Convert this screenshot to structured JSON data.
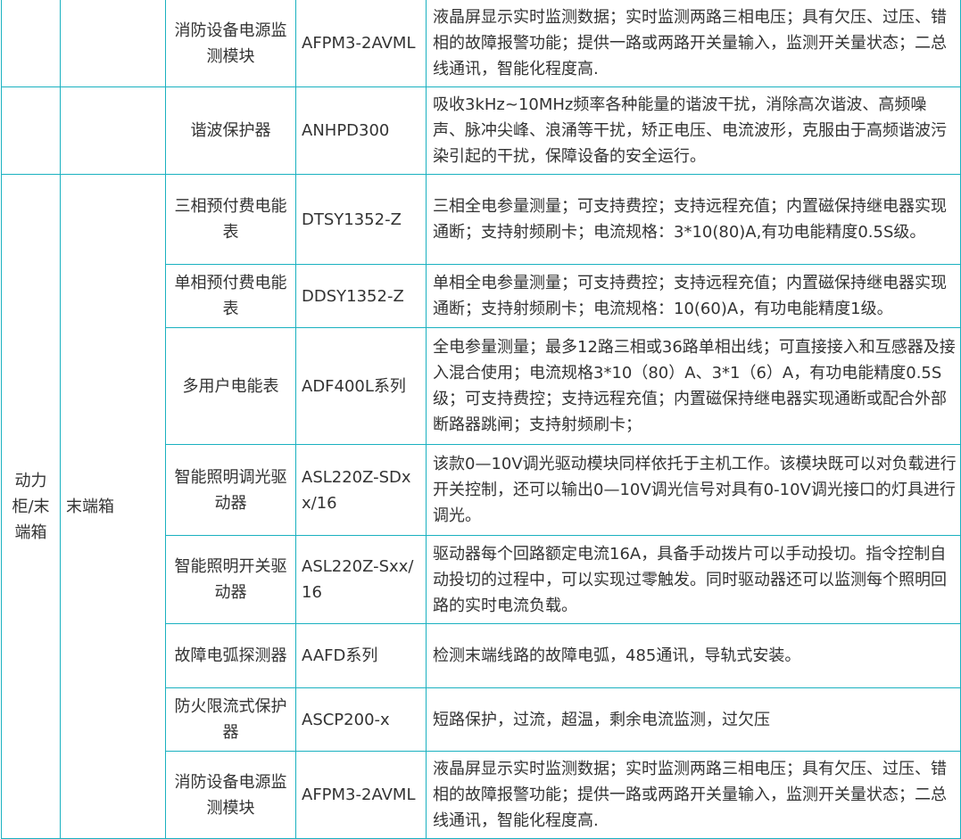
{
  "table": {
    "rows": [
      {
        "name": "消防设备电源监测模块",
        "model": "AFPM3-2AVML",
        "desc": "液晶屏显示实时监测数据；实时监测两路三相电压；具有欠压、过压、错相的故障报警功能；提供一路或两路开关量输入，监测开关量状态；二总线通讯，智能化程度高."
      },
      {
        "name": "谐波保护器",
        "model": "ANHPD300",
        "desc": "吸收3kHz~10MHz频率各种能量的谐波干扰，消除高次谐波、高频噪声、脉冲尖峰、浪涌等干扰，矫正电压、电流波形，克服由于高频谐波污染引起的干扰，保障设备的安全运行。"
      }
    ],
    "group": {
      "cat1": "动力柜/末端箱",
      "cat2": "末端箱",
      "rows": [
        {
          "name": "三相预付费电能表",
          "model": "DTSY1352-Z",
          "desc": "三相全电参量测量；可支持费控；支持远程充值；内置磁保持继电器实现通断；支持射频刷卡；电流规格：3*10(80)A,有功电能精度0.5S级。"
        },
        {
          "name": "单相预付费电能表",
          "model": "DDSY1352-Z",
          "desc": "单相全电参量测量；可支持费控；支持远程充值；内置磁保持继电器实现通断；支持射频刷卡；电流规格：10(60)A，有功电能精度1级。"
        },
        {
          "name": "多用户电能表",
          "model": "ADF400L系列",
          "desc": "全电参量测量；最多12路三相或36路单相出线；可直接接入和互感器及接入混合使用；电流规格3*10（80）A、3*1（6）A，有功电能精度0.5S级；可支持费控；支持远程充值；内置磁保持继电器实现通断或配合外部断路器跳闸；支持射频刷卡；"
        },
        {
          "name": "智能照明调光驱动器",
          "model": "ASL220Z-SDxx/16",
          "desc": "该款0—10V调光驱动模块同样依托于主机工作。该模块既可以对负载进行开关控制，还可以输出0—10V调光信号对具有0-10V调光接口的灯具进行调光。"
        },
        {
          "name": "智能照明开关驱动器",
          "model": "ASL220Z-Sxx/16",
          "desc": "驱动器每个回路额定电流16A，具备手动拨片可以手动投切。指令控制自动投切的过程中，可以实现过零触发。同时驱动器还可以监测每个照明回路的实时电流负载。"
        },
        {
          "name": "故障电弧探测器",
          "model": "AAFD系列",
          "desc": "检测末端线路的故障电弧，485通讯，导轨式安装。"
        },
        {
          "name": "防火限流式保护器",
          "model": "ASCP200-x",
          "desc": "短路保护，过流，超温，剩余电流监测，过欠压"
        },
        {
          "name": "消防设备电源监测模块",
          "model": "AFPM3-2AVML",
          "desc": "液晶屏显示实时监测数据；实时监测两路三相电压；具有欠压、过压、错相的故障报警功能；提供一路或两路开关量输入，监测开关量状态；二总线通讯，智能化程度高."
        }
      ]
    }
  }
}
